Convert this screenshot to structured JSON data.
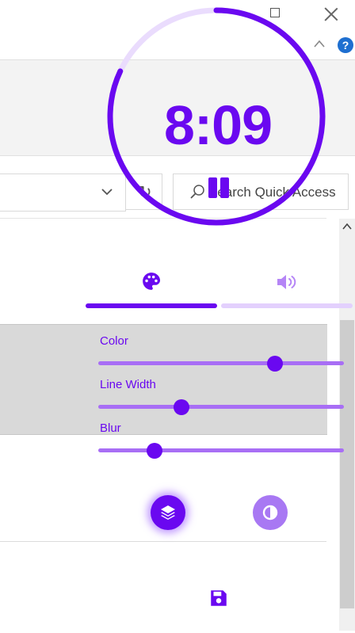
{
  "explorer": {
    "search_placeholder": "Search Quick Access",
    "refresh_icon": "refresh-icon",
    "help_label": "?"
  },
  "timer": {
    "time": "8:09",
    "progress": 0.82
  },
  "tabs": [
    {
      "icon": "palette-icon",
      "active": true
    },
    {
      "icon": "sound-icon",
      "active": false
    }
  ],
  "sliders": [
    {
      "label": "Color",
      "value": 0.72
    },
    {
      "label": "Line Width",
      "value": 0.34
    },
    {
      "label": "Blur",
      "value": 0.23
    }
  ],
  "mode_buttons": [
    {
      "icon": "layers-icon",
      "active": true
    },
    {
      "icon": "contrast-icon",
      "active": false
    }
  ],
  "save_icon": "save-icon",
  "colors": {
    "accent": "#6a08f0",
    "accent_light": "#a878f3",
    "ring_track": "#eadcfd",
    "band": "#d9d9d9"
  }
}
